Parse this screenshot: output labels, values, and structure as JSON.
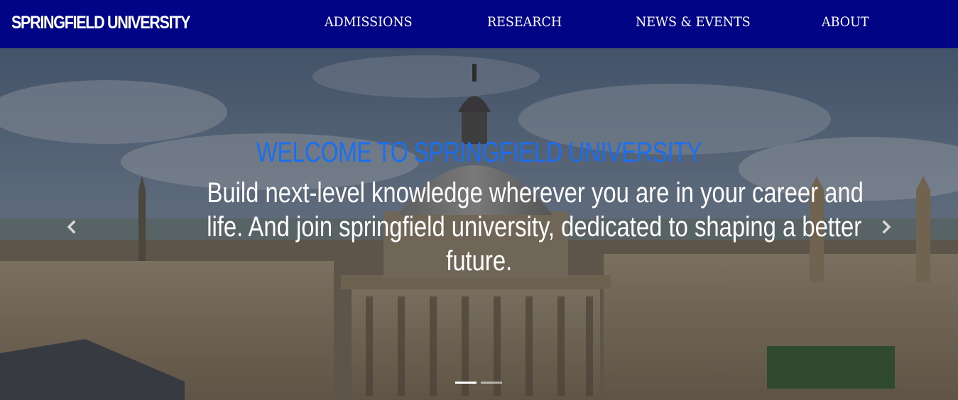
{
  "navbar": {
    "brand": "SPRINGFIELD UNIVERSITY",
    "items": [
      {
        "label": "ADMISSIONS"
      },
      {
        "label": "RESEARCH"
      },
      {
        "label": "NEWS & EVENTS"
      },
      {
        "label": "ABOUT"
      }
    ],
    "background_color": "#020486"
  },
  "hero": {
    "title": "WELCOME TO SPRINGFIELD UNIVERSITY",
    "text_line1": "Build next-level knowledge wherever you are in your career and",
    "text_line2": "life. And join springfield university, dedicated to shaping a better",
    "text_line3": "future.",
    "title_color": "#1a6ef0",
    "prev_icon": "chevron-left-icon",
    "next_icon": "chevron-right-icon",
    "indicators": [
      {
        "active": true
      },
      {
        "active": false
      }
    ]
  }
}
